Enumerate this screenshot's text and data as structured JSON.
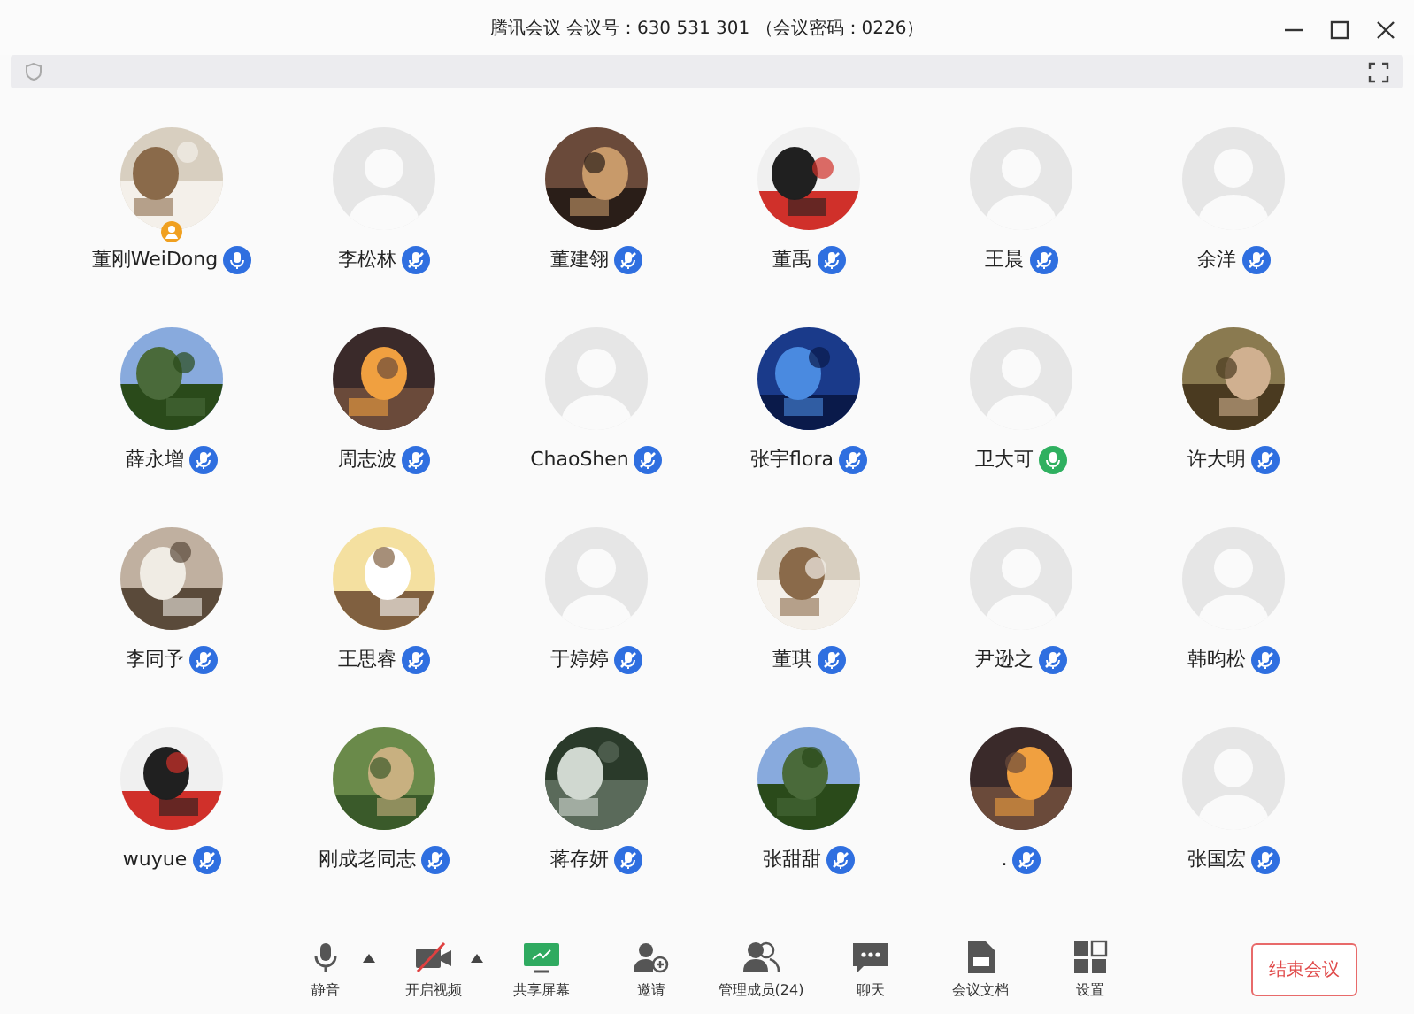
{
  "window": {
    "title": "腾讯会议 会议号：630 531 301 （会议密码：0226）"
  },
  "participants": [
    {
      "name": "董刚WeiDong",
      "photo": true,
      "host": true,
      "muted": false,
      "speaking": false
    },
    {
      "name": "李松林",
      "photo": false,
      "host": false,
      "muted": true,
      "speaking": false
    },
    {
      "name": "董建翎",
      "photo": true,
      "host": false,
      "muted": true,
      "speaking": false
    },
    {
      "name": "董禹",
      "photo": true,
      "host": false,
      "muted": true,
      "speaking": false
    },
    {
      "name": "王晨",
      "photo": false,
      "host": false,
      "muted": true,
      "speaking": false
    },
    {
      "name": "余洋",
      "photo": false,
      "host": false,
      "muted": true,
      "speaking": false
    },
    {
      "name": "薛永增",
      "photo": true,
      "host": false,
      "muted": true,
      "speaking": false
    },
    {
      "name": "周志波",
      "photo": true,
      "host": false,
      "muted": true,
      "speaking": false
    },
    {
      "name": "ChaoShen",
      "photo": false,
      "host": false,
      "muted": true,
      "speaking": false
    },
    {
      "name": "张宇flora",
      "photo": true,
      "host": false,
      "muted": true,
      "speaking": false
    },
    {
      "name": "卫大可",
      "photo": false,
      "host": false,
      "muted": false,
      "speaking": true
    },
    {
      "name": "许大明",
      "photo": true,
      "host": false,
      "muted": true,
      "speaking": false
    },
    {
      "name": "李同予",
      "photo": true,
      "host": false,
      "muted": true,
      "speaking": false
    },
    {
      "name": "王思睿",
      "photo": true,
      "host": false,
      "muted": true,
      "speaking": false
    },
    {
      "name": "于婷婷",
      "photo": false,
      "host": false,
      "muted": true,
      "speaking": false
    },
    {
      "name": "董琪",
      "photo": true,
      "host": false,
      "muted": true,
      "speaking": false
    },
    {
      "name": "尹逊之",
      "photo": false,
      "host": false,
      "muted": true,
      "speaking": false
    },
    {
      "name": "韩昀松",
      "photo": false,
      "host": false,
      "muted": true,
      "speaking": false
    },
    {
      "name": "wuyue",
      "photo": true,
      "host": false,
      "muted": true,
      "speaking": false
    },
    {
      "name": "刚成老同志",
      "photo": true,
      "host": false,
      "muted": true,
      "speaking": false
    },
    {
      "name": "蒋存妍",
      "photo": true,
      "host": false,
      "muted": true,
      "speaking": false
    },
    {
      "name": "张甜甜",
      "photo": true,
      "host": false,
      "muted": true,
      "speaking": false
    },
    {
      "name": ".",
      "photo": true,
      "host": false,
      "muted": true,
      "speaking": false
    },
    {
      "name": "张国宏",
      "photo": false,
      "host": false,
      "muted": true,
      "speaking": false
    }
  ],
  "toolbar": [
    {
      "kind": "mic",
      "label": "静音",
      "caret": true
    },
    {
      "kind": "video",
      "label": "开启视频",
      "caret": true
    },
    {
      "kind": "share",
      "label": "共享屏幕",
      "caret": false
    },
    {
      "kind": "invite",
      "label": "邀请",
      "caret": false
    },
    {
      "kind": "members",
      "label": "管理成员(24)",
      "caret": false
    },
    {
      "kind": "chat",
      "label": "聊天",
      "caret": false
    },
    {
      "kind": "docs",
      "label": "会议文档",
      "caret": false
    },
    {
      "kind": "settings",
      "label": "设置",
      "caret": false
    }
  ],
  "end_button": "结束会议"
}
